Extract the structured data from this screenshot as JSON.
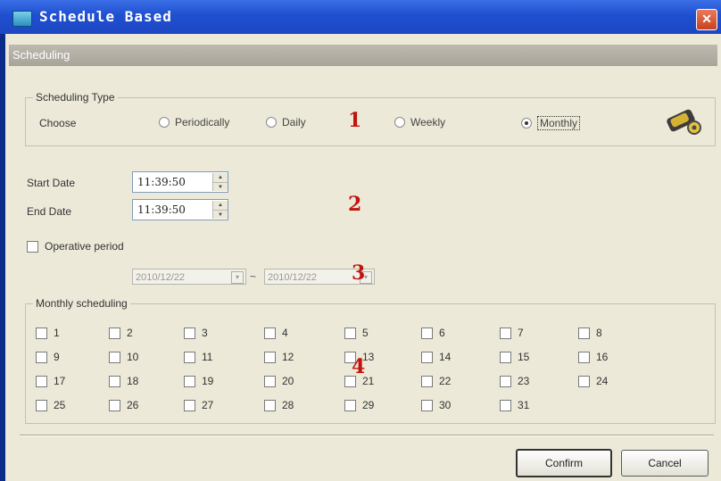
{
  "window": {
    "title": "Schedule Based",
    "close_glyph": "✕"
  },
  "section_header": "Scheduling",
  "scheduling_type": {
    "legend": "Scheduling Type",
    "choose_label": "Choose",
    "options": [
      {
        "label": "Periodically",
        "selected": false
      },
      {
        "label": "Daily",
        "selected": false
      },
      {
        "label": "Weekly",
        "selected": false
      },
      {
        "label": "Monthly",
        "selected": true
      }
    ],
    "icon": "camera-icon"
  },
  "markers": {
    "m1": "1",
    "m2": "2",
    "m3": "3",
    "m4": "4"
  },
  "start_date": {
    "label": "Start Date",
    "value": "11:39:50"
  },
  "end_date": {
    "label": "End Date",
    "value": "11:39:50"
  },
  "operative_period": {
    "label": "Operative period",
    "checked": false,
    "from": "2010/12/22",
    "separator": "~",
    "to": "2010/12/22"
  },
  "monthly": {
    "legend": "Monthly scheduling",
    "days": [
      "1",
      "2",
      "3",
      "4",
      "5",
      "6",
      "7",
      "8",
      "9",
      "10",
      "11",
      "12",
      "13",
      "14",
      "15",
      "16",
      "17",
      "18",
      "19",
      "20",
      "21",
      "22",
      "23",
      "24",
      "25",
      "26",
      "27",
      "28",
      "29",
      "30",
      "31"
    ]
  },
  "buttons": {
    "confirm": "Confirm",
    "cancel": "Cancel"
  }
}
